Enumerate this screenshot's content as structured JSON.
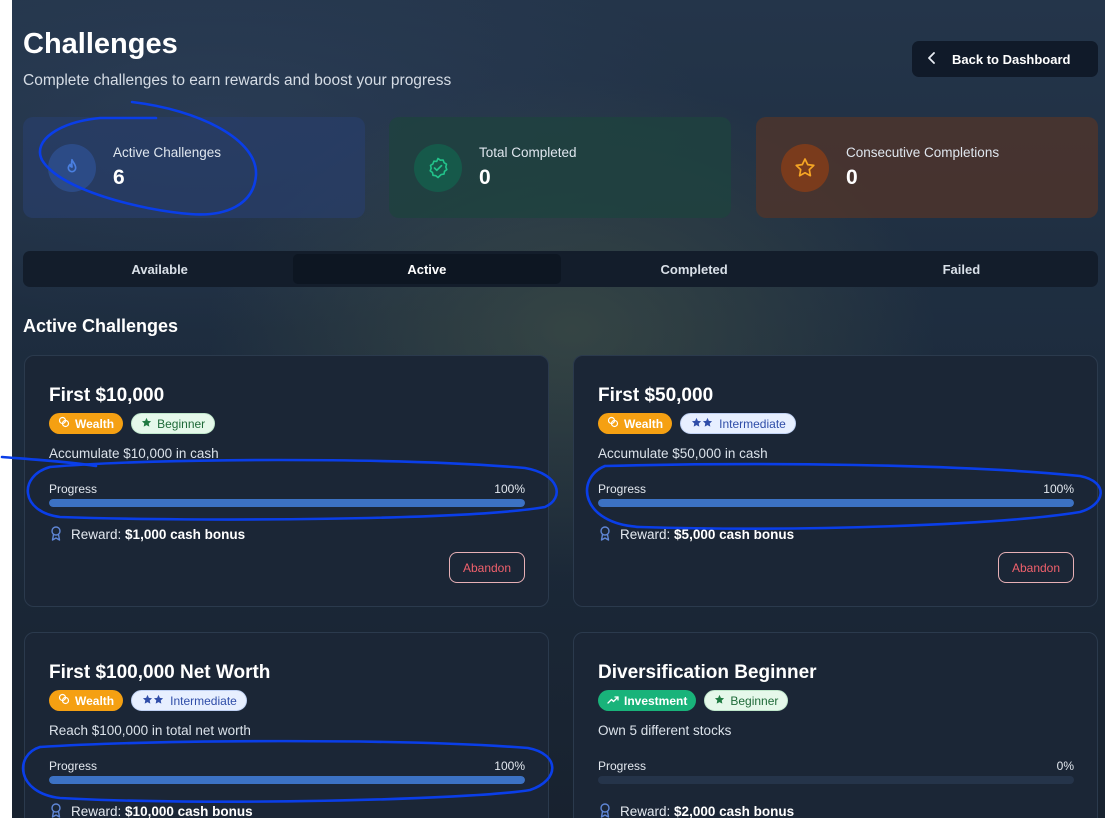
{
  "header": {
    "title": "Challenges",
    "subtitle": "Complete challenges to earn rewards and boost your progress",
    "back_label": "Back to Dashboard"
  },
  "stats": [
    {
      "label": "Active Challenges",
      "value": "6",
      "icon": "flame-icon",
      "color": "#4a7fe0"
    },
    {
      "label": "Total Completed",
      "value": "0",
      "icon": "badge-check-icon",
      "color": "#22c38a"
    },
    {
      "label": "Consecutive Completions",
      "value": "0",
      "icon": "star-icon",
      "color": "#f5a524"
    }
  ],
  "tabs": [
    {
      "label": "Available",
      "active": false
    },
    {
      "label": "Active",
      "active": true
    },
    {
      "label": "Completed",
      "active": false
    },
    {
      "label": "Failed",
      "active": false
    }
  ],
  "section_title": "Active Challenges",
  "cards": [
    {
      "title": "First $10,000",
      "category": "Wealth",
      "category_icon": "coins-icon",
      "level": "Beginner",
      "level_stars": 1,
      "description": "Accumulate $10,000 in cash",
      "progress_label": "Progress",
      "progress_text": "100%",
      "progress": 1.0,
      "reward_label": "Reward:",
      "reward_value": "$1,000 cash bonus",
      "action_label": "Abandon"
    },
    {
      "title": "First $50,000",
      "category": "Wealth",
      "category_icon": "coins-icon",
      "level": "Intermediate",
      "level_stars": 2,
      "description": "Accumulate $50,000 in cash",
      "progress_label": "Progress",
      "progress_text": "100%",
      "progress": 1.0,
      "reward_label": "Reward:",
      "reward_value": "$5,000 cash bonus",
      "action_label": "Abandon"
    },
    {
      "title": "First $100,000 Net Worth",
      "category": "Wealth",
      "category_icon": "coins-icon",
      "level": "Intermediate",
      "level_stars": 2,
      "description": "Reach $100,000 in total net worth",
      "progress_label": "Progress",
      "progress_text": "100%",
      "progress": 1.0,
      "reward_label": "Reward:",
      "reward_value": "$10,000 cash bonus"
    },
    {
      "title": "Diversification Beginner",
      "category": "Investment",
      "category_icon": "trending-up-icon",
      "level": "Beginner",
      "level_stars": 1,
      "description": "Own 5 different stocks",
      "progress_label": "Progress",
      "progress_text": "0%",
      "progress": 0.0,
      "reward_label": "Reward:",
      "reward_value": "$2,000 cash bonus"
    }
  ],
  "annotation_color": "#0a3ee8"
}
